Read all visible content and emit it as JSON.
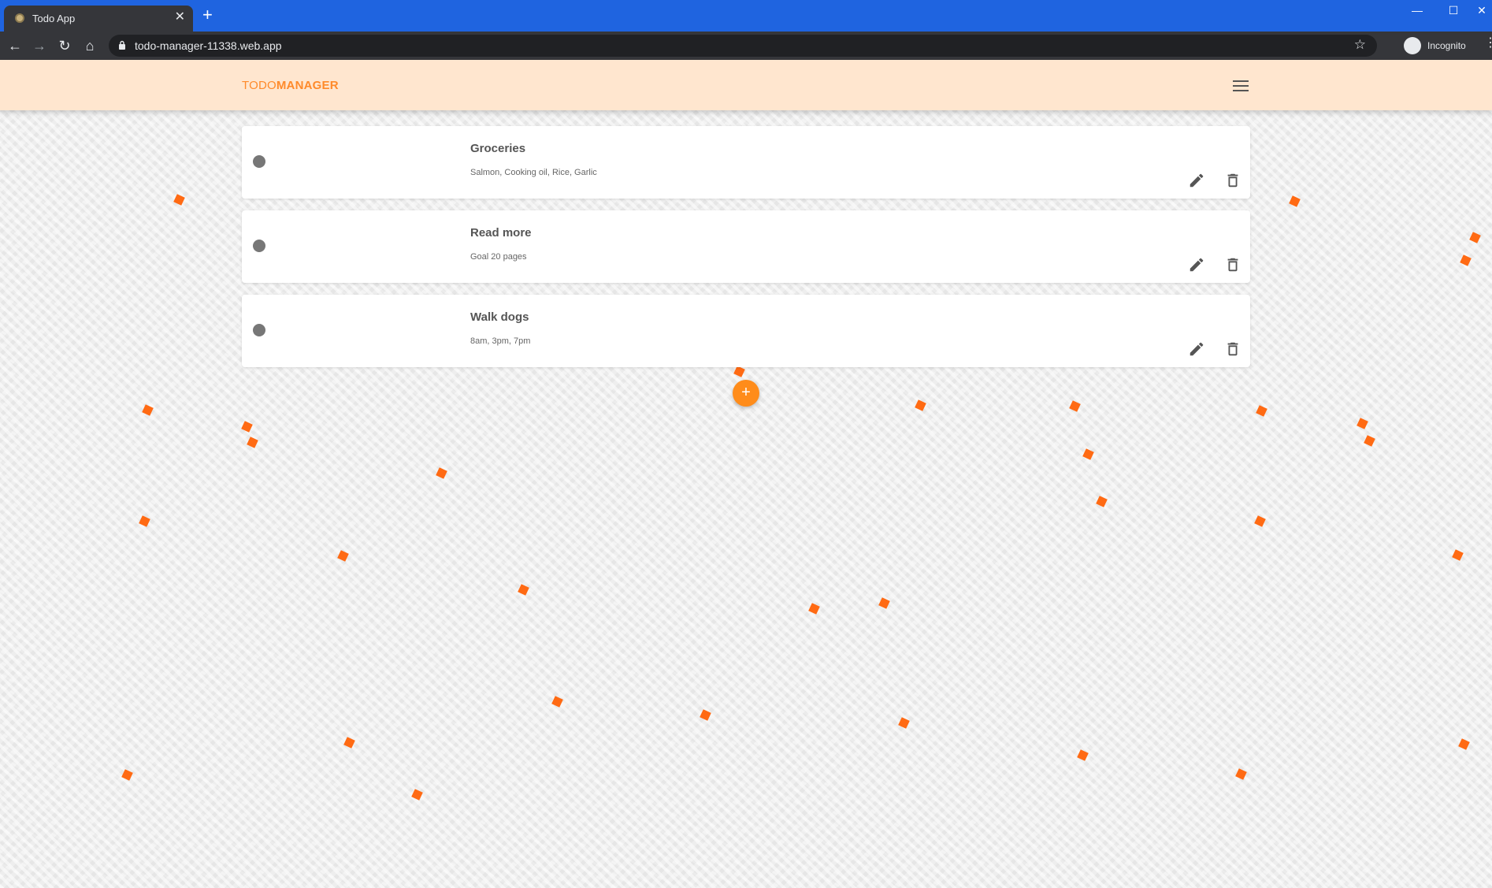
{
  "browser": {
    "tab_title": "Todo App",
    "tab_close": "✕",
    "new_tab": "+",
    "url": "todo-manager-11338.web.app",
    "incognito_label": "Incognito",
    "window_min": "—",
    "window_max": "☐",
    "window_close": "✕"
  },
  "app": {
    "brand_light": "TODO",
    "brand_bold": "MANAGER",
    "accent_color": "#ff8a2a",
    "appbar_color": "#ffe6cf",
    "fab_label": "+"
  },
  "todos": [
    {
      "title": "Groceries",
      "description": "Salmon, Cooking oil, Rice, Garlic"
    },
    {
      "title": "Read more",
      "description": "Goal 20 pages"
    },
    {
      "title": "Walk dogs",
      "description": "8am, 3pm, 7pm"
    }
  ]
}
